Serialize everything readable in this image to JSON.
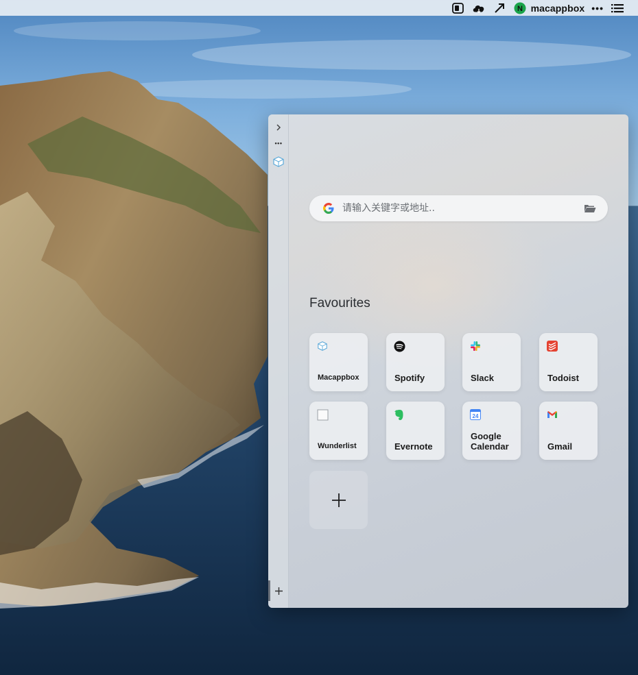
{
  "menubar": {
    "username": "macappbox",
    "more_label": "•••",
    "icons": [
      "sidebar-toggle-icon",
      "cloud-icon",
      "arrow-icon",
      "n-avatar-icon",
      "list-icon"
    ],
    "avatar_letter": "N",
    "avatar_color": "#1aa34a"
  },
  "sidebar": {
    "collapse_label": "›",
    "more_label": "•••",
    "add_label": "+",
    "icons": [
      "chevron-right-icon",
      "more-icon",
      "macappbox-icon",
      "plus-icon"
    ]
  },
  "search": {
    "placeholder": "请输入关键字或地址..",
    "engine_icon": "google-icon",
    "right_icon": "folder-icon"
  },
  "favourites": {
    "title": "Favourites",
    "items": [
      {
        "label": "Macappbox",
        "icon": "macappbox-icon"
      },
      {
        "label": "Spotify",
        "icon": "spotify-icon"
      },
      {
        "label": "Slack",
        "icon": "slack-icon"
      },
      {
        "label": "Todoist",
        "icon": "todoist-icon"
      },
      {
        "label": "Wunderlist",
        "icon": "wunderlist-icon"
      },
      {
        "label": "Evernote",
        "icon": "evernote-icon"
      },
      {
        "label": "Google Calendar",
        "label_line1": "Google",
        "label_line2": "Calendar",
        "icon": "google-calendar-icon",
        "calendar_day": "24"
      },
      {
        "label": "Gmail",
        "icon": "gmail-icon"
      }
    ],
    "add_label": "+"
  },
  "colors": {
    "spotify": "#111111",
    "todoist": "#e44332",
    "evernote": "#2dbe60",
    "google_blue": "#4285f4",
    "gmail_red": "#ea4335"
  }
}
